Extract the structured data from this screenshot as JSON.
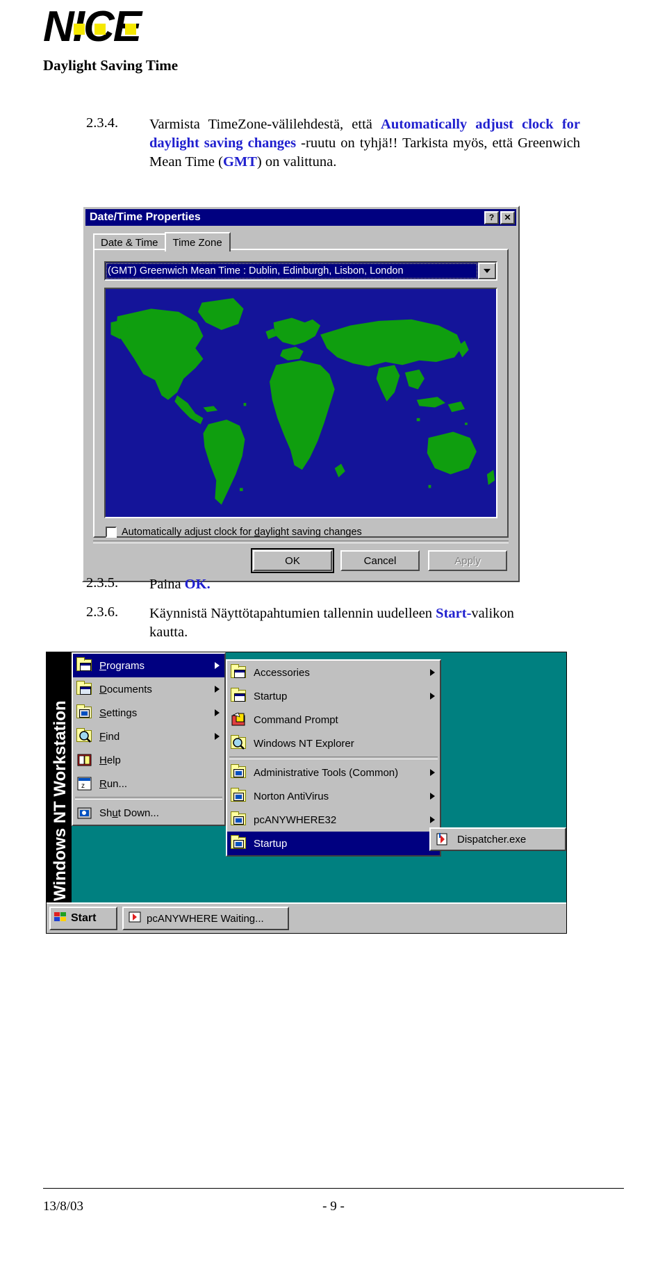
{
  "header": {
    "logo_text": "NICE",
    "title": "Daylight Saving Time"
  },
  "steps": {
    "s234_num": "2.3.4.",
    "s234_a": "Varmista TimeZone-välilehdestä, että ",
    "s234_b": "Automatically adjust clock for daylight saving changes",
    "s234_c": " -ruutu on tyhjä!! Tarkista myös, että Greenwich Mean Time (",
    "s234_d": "GMT",
    "s234_e": ") on valittuna.",
    "s235_num": "2.3.5.",
    "s235_a": "Paina ",
    "s235_b": "OK.",
    "s236_num": "2.3.6.",
    "s236_a": "Käynnistä  Näyttötapahtumien tallennin uudelleen ",
    "s236_b": "Start-",
    "s236_c": "valikon kautta."
  },
  "dialog": {
    "title": "Date/Time Properties",
    "help_button": "?",
    "close_button": "✕",
    "tabs": [
      {
        "label": "Date & Time",
        "active": false
      },
      {
        "label": "Time Zone",
        "active": true
      }
    ],
    "timezone_selected": "(GMT) Greenwich Mean Time : Dublin, Edinburgh, Lisbon, London",
    "checkbox_label_pre": "Automatically adjust clock for ",
    "checkbox_label_accel": "d",
    "checkbox_label_post": "aylight saving changes",
    "checkbox_checked": false,
    "buttons": [
      {
        "label": "OK",
        "state": "default"
      },
      {
        "label": "Cancel",
        "state": "normal"
      },
      {
        "label": "Apply",
        "state": "disabled"
      }
    ],
    "colors": {
      "titlebar": "#000080",
      "face": "#c0c0c0",
      "map_ocean": "#141499",
      "map_land": "#0f9e0f"
    }
  },
  "startmenu": {
    "banner_label": "Windows NT Workstation",
    "level1": [
      {
        "label_pre": "",
        "accel": "P",
        "label_post": "rograms",
        "icon": "programs-folder-icon",
        "submenu": true,
        "selected": true
      },
      {
        "label_pre": "",
        "accel": "D",
        "label_post": "ocuments",
        "icon": "documents-folder-icon",
        "submenu": true,
        "selected": false
      },
      {
        "label_pre": "",
        "accel": "S",
        "label_post": "ettings",
        "icon": "settings-gear-icon",
        "submenu": true,
        "selected": false
      },
      {
        "label_pre": "",
        "accel": "F",
        "label_post": "ind",
        "icon": "find-magnifier-icon",
        "submenu": true,
        "selected": false
      },
      {
        "label_pre": "",
        "accel": "H",
        "label_post": "elp",
        "icon": "help-book-icon",
        "submenu": false,
        "selected": false
      },
      {
        "label_pre": "",
        "accel": "R",
        "label_post": "un...",
        "icon": "run-icon",
        "submenu": false,
        "selected": false
      },
      {
        "label_pre": "Sh",
        "accel": "u",
        "label_post": "t Down...",
        "icon": "shutdown-icon",
        "submenu": false,
        "selected": false
      }
    ],
    "level2": [
      {
        "label": "Accessories",
        "icon": "folder-program-icon",
        "submenu": true,
        "selected": false
      },
      {
        "label": "Startup",
        "icon": "folder-program-icon",
        "submenu": true,
        "selected": false
      },
      {
        "label": "Command Prompt",
        "icon": "command-prompt-icon",
        "submenu": false,
        "selected": false
      },
      {
        "label": "Windows NT Explorer",
        "icon": "explorer-icon",
        "submenu": false,
        "selected": false
      },
      {
        "label": "Administrative Tools (Common)",
        "icon": "folder-admin-icon",
        "submenu": true,
        "selected": false
      },
      {
        "label": "Norton AntiVirus",
        "icon": "folder-admin-icon",
        "submenu": true,
        "selected": false
      },
      {
        "label": "pcANYWHERE32",
        "icon": "folder-admin-icon",
        "submenu": true,
        "selected": false
      },
      {
        "label": "Startup",
        "icon": "folder-admin-icon",
        "submenu": true,
        "selected": true
      }
    ],
    "level3": [
      {
        "label": "Dispatcher.exe",
        "icon": "exe-icon",
        "selected": false
      }
    ],
    "taskbar": {
      "start_label": "Start",
      "task_label": "pcANYWHERE Waiting..."
    },
    "desktop_color": "#008080"
  },
  "footer": {
    "date": "13/8/03",
    "page": "- 9 -"
  }
}
